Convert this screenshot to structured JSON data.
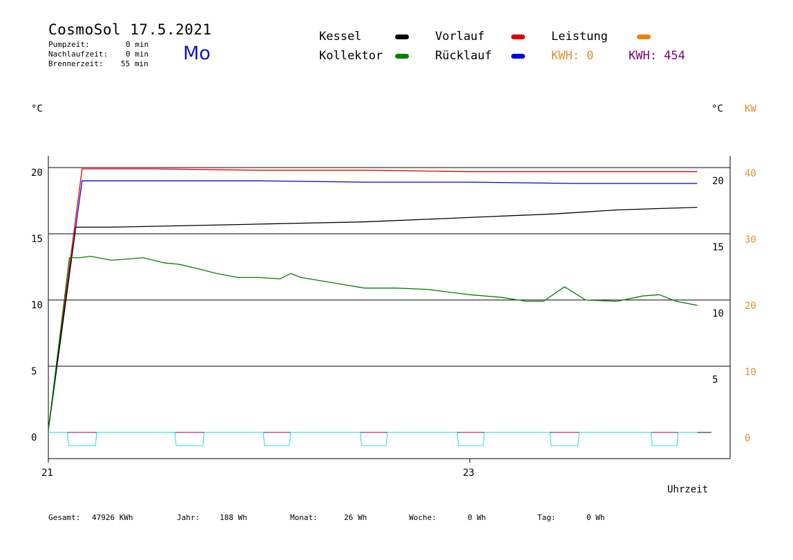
{
  "header": {
    "title": "CosmoSol 17.5.2021",
    "day": "Mo",
    "stats": [
      {
        "label": "Pumpzeit:",
        "value": "0 min"
      },
      {
        "label": "Nachlaufzeit:",
        "value": "0 min"
      },
      {
        "label": "Brennerzeit:",
        "value": "55 min"
      }
    ]
  },
  "legend": {
    "kessel": {
      "label": "Kessel",
      "color": "#000000"
    },
    "vorlauf": {
      "label": "Vorlauf",
      "color": "#e00000"
    },
    "leistung": {
      "label": "Leistung",
      "color": "#f08010"
    },
    "kollektor": {
      "label": "Kollektor",
      "color": "#008000"
    },
    "ruecklauf": {
      "label": "Rücklauf",
      "color": "#0000e0"
    },
    "kwh_a": {
      "text": "KWH: 0",
      "color": "#e09030"
    },
    "kwh_b": {
      "text": "KWH: 454",
      "color": "#800080"
    }
  },
  "axes": {
    "left_unit": "°C",
    "right_unit": "°C",
    "right2_unit": "KW",
    "xlabel": "Uhrzeit"
  },
  "footer": [
    {
      "label": "Gesamt:",
      "value": "47926 KWh"
    },
    {
      "label": "Jahr:",
      "value": "188 Wh"
    },
    {
      "label": "Monat:",
      "value": "26 Wh"
    },
    {
      "label": "Woche:",
      "value": "0 Wh"
    },
    {
      "label": "Tag:",
      "value": "0 Wh"
    }
  ],
  "chart_data": {
    "type": "line",
    "x_unit": "hour of day",
    "x_ticks": [
      21,
      23
    ],
    "xlim": [
      21,
      24.1
    ],
    "ylim": [
      -2,
      20.8
    ],
    "y_ticks_left": [
      0,
      5,
      10,
      15,
      20
    ],
    "y_ticks_right": [
      5,
      10,
      15,
      20
    ],
    "y_ticks_kw": [
      0,
      10,
      20,
      30,
      40
    ],
    "kw_scale_factor": 2,
    "grid": true,
    "series": [
      {
        "name": "Vorlauf",
        "color": "#e00000",
        "x": [
          21.0,
          21.16,
          21.5,
          22.0,
          22.5,
          23.0,
          23.5,
          24.08
        ],
        "y": [
          0.2,
          19.9,
          19.9,
          19.8,
          19.8,
          19.7,
          19.7,
          19.7
        ]
      },
      {
        "name": "Rücklauf",
        "color": "#0000e0",
        "x": [
          21.0,
          21.16,
          21.5,
          22.0,
          22.5,
          23.0,
          23.5,
          24.08
        ],
        "y": [
          0.2,
          19.0,
          19.0,
          19.0,
          18.9,
          18.9,
          18.8,
          18.8
        ]
      },
      {
        "name": "Kessel",
        "color": "#000000",
        "x": [
          21.13,
          21.3,
          21.6,
          21.9,
          22.2,
          22.5,
          22.8,
          23.1,
          23.4,
          23.7,
          24.08
        ],
        "y": [
          15.5,
          15.5,
          15.6,
          15.7,
          15.8,
          15.9,
          16.1,
          16.3,
          16.5,
          16.8,
          17.0
        ],
        "x_start_jump": 21.13
      },
      {
        "name": "Kollektor",
        "color": "#008000",
        "x": [
          21.1,
          21.15,
          21.2,
          21.3,
          21.38,
          21.45,
          21.55,
          21.62,
          21.7,
          21.8,
          21.9,
          22.0,
          22.1,
          22.15,
          22.2,
          22.35,
          22.5,
          22.65,
          22.8,
          22.95,
          23.0,
          23.15,
          23.27,
          23.35,
          23.45,
          23.55,
          23.7,
          23.82,
          23.9,
          23.98,
          24.08
        ],
        "y": [
          13.2,
          13.2,
          13.3,
          13.0,
          13.1,
          13.2,
          12.8,
          12.7,
          12.4,
          12.0,
          11.7,
          11.7,
          11.6,
          12.0,
          11.7,
          11.3,
          10.9,
          10.9,
          10.8,
          10.5,
          10.4,
          10.2,
          9.9,
          9.9,
          11.0,
          10.0,
          9.9,
          10.3,
          10.4,
          9.9,
          9.6
        ]
      },
      {
        "name": "Leistung",
        "color": "#40e0e0",
        "baseline": 0,
        "dip": -1.0,
        "dips": [
          [
            21.09,
            21.23
          ],
          [
            21.6,
            21.74
          ],
          [
            22.02,
            22.15
          ],
          [
            22.48,
            22.61
          ],
          [
            22.94,
            23.07
          ],
          [
            23.38,
            23.52
          ],
          [
            23.86,
            23.99
          ]
        ]
      }
    ]
  }
}
